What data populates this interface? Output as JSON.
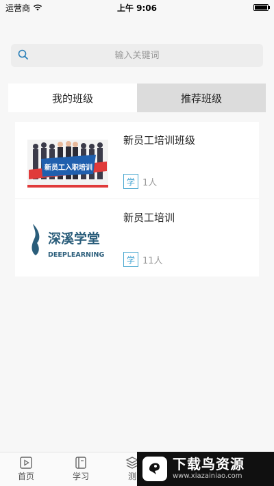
{
  "status_bar": {
    "carrier": "运营商",
    "time": "上午 9:06"
  },
  "search": {
    "placeholder": "输入关键词"
  },
  "tabs": [
    {
      "label": "我的班级",
      "active": true
    },
    {
      "label": "推荐班级",
      "active": false
    }
  ],
  "classes": [
    {
      "title": "新员工培训班级",
      "badge": "学",
      "count": "1人",
      "banner_text": "新员工入职培训"
    },
    {
      "title": "新员工培训",
      "badge": "学",
      "count": "11人",
      "logo_cn": "深溪学堂",
      "logo_en": "DEEPLEARNING"
    }
  ],
  "bottom_nav": [
    {
      "label": "首页",
      "icon": "video-icon"
    },
    {
      "label": "学习",
      "icon": "book-icon"
    },
    {
      "label": "测",
      "icon": "layers-icon"
    }
  ],
  "watermark": {
    "title": "下载鸟资源",
    "url": "www.xiazainiao.com"
  },
  "colors": {
    "accent": "#3a9fd0",
    "logo_blue": "#2a5d7a",
    "banner_red": "#e03a3a"
  }
}
